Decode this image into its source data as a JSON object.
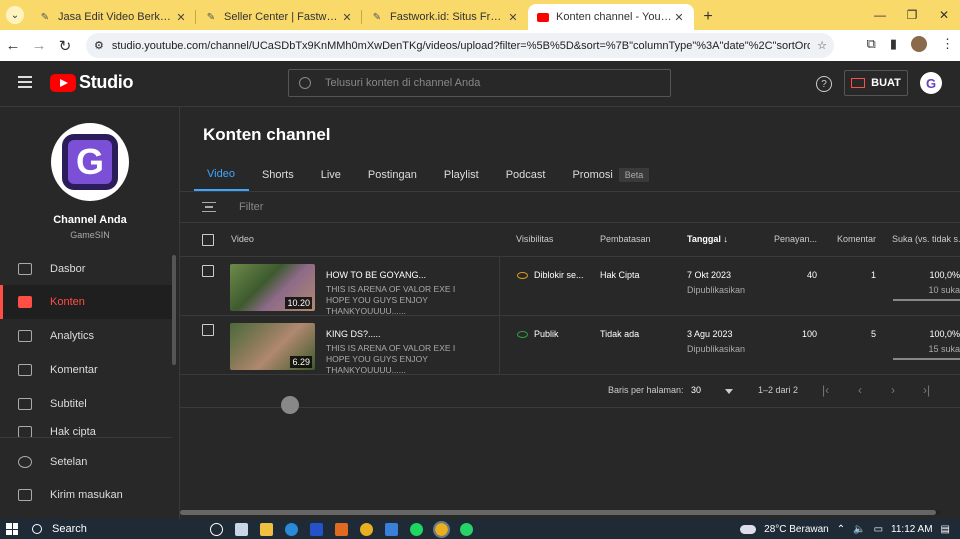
{
  "browser": {
    "tabs": [
      {
        "title": "Jasa Edit Video Berkualitas, Mu",
        "icon": "fastwork-icon"
      },
      {
        "title": "Seller Center | Fastwork.id",
        "icon": "fastwork-icon"
      },
      {
        "title": "Fastwork.id: Situs Freelance Onl",
        "icon": "fastwork-icon"
      },
      {
        "title": "Konten channel - YouTube Studi",
        "icon": "youtube-icon"
      }
    ],
    "url": "studio.youtube.com/channel/UCaSDbTx9KnMMh0mXwDenTKg/videos/upload?filter=%5B%5D&sort=%7B\"columnType\"%3A\"date\"%2C\"sortOrder\"%3A\"DESCE..."
  },
  "topbar": {
    "logo_text": "Studio",
    "search_placeholder": "Telusuri konten di channel Anda",
    "create_label": "BUAT"
  },
  "channel": {
    "name": "Channel Anda",
    "handle": "GameSIN",
    "avatar_letter": "G"
  },
  "sidebar": {
    "items": [
      {
        "label": "Dasbor",
        "icon": "dashboard-icon"
      },
      {
        "label": "Konten",
        "icon": "content-icon",
        "active": true
      },
      {
        "label": "Analytics",
        "icon": "analytics-icon"
      },
      {
        "label": "Komentar",
        "icon": "comments-icon"
      },
      {
        "label": "Subtitel",
        "icon": "subtitles-icon"
      },
      {
        "label": "Hak cipta",
        "icon": "copyright-icon"
      }
    ],
    "bottom_items": [
      {
        "label": "Setelan",
        "icon": "settings-icon"
      },
      {
        "label": "Kirim masukan",
        "icon": "feedback-icon"
      }
    ]
  },
  "main": {
    "title": "Konten channel",
    "tabs": [
      "Video",
      "Shorts",
      "Live",
      "Postingan",
      "Playlist",
      "Podcast",
      "Promosi"
    ],
    "beta_label": "Beta",
    "filter_placeholder": "Filter",
    "columns": {
      "video": "Video",
      "visibility": "Visibilitas",
      "restrictions": "Pembatasan",
      "date": "Tanggal",
      "views": "Penayan...",
      "comments": "Komentar",
      "likes": "Suka (vs. tidak s..."
    },
    "rows": [
      {
        "title": "HOW TO BE GOYANG...",
        "description": "THIS IS ARENA OF VALOR EXE I HOPE YOU GUYS ENJOY THANKYOUUUU......",
        "duration": "10.20",
        "visibility": "Diblokir se...",
        "restriction": "Hak Cipta",
        "date": "7 Okt 2023",
        "date_status": "Dipublikasikan",
        "views": "40",
        "comments": "1",
        "likes_pct": "100,0%",
        "likes_count": "10 suka",
        "likes_ratio": 1.0
      },
      {
        "title": "KING DS?.....",
        "description": "THIS IS ARENA OF VALOR EXE I HOPE YOU GUYS ENJOY THANKYOUUUU......",
        "duration": "6.29",
        "visibility": "Publik",
        "restriction": "Tidak ada",
        "date": "3 Agu 2023",
        "date_status": "Dipublikasikan",
        "views": "100",
        "comments": "5",
        "likes_pct": "100,0%",
        "likes_count": "15 suka",
        "likes_ratio": 1.0
      }
    ],
    "pagination": {
      "rows_label": "Baris per halaman:",
      "rows_value": "30",
      "range": "1–2 dari 2"
    }
  },
  "taskbar": {
    "search_label": "Search",
    "weather": "28°C  Berawan",
    "time": "11:12 AM"
  },
  "colors": {
    "accent": "#3ea6ff",
    "brand": "#ff0000",
    "active_nav": "#ff4e45"
  }
}
